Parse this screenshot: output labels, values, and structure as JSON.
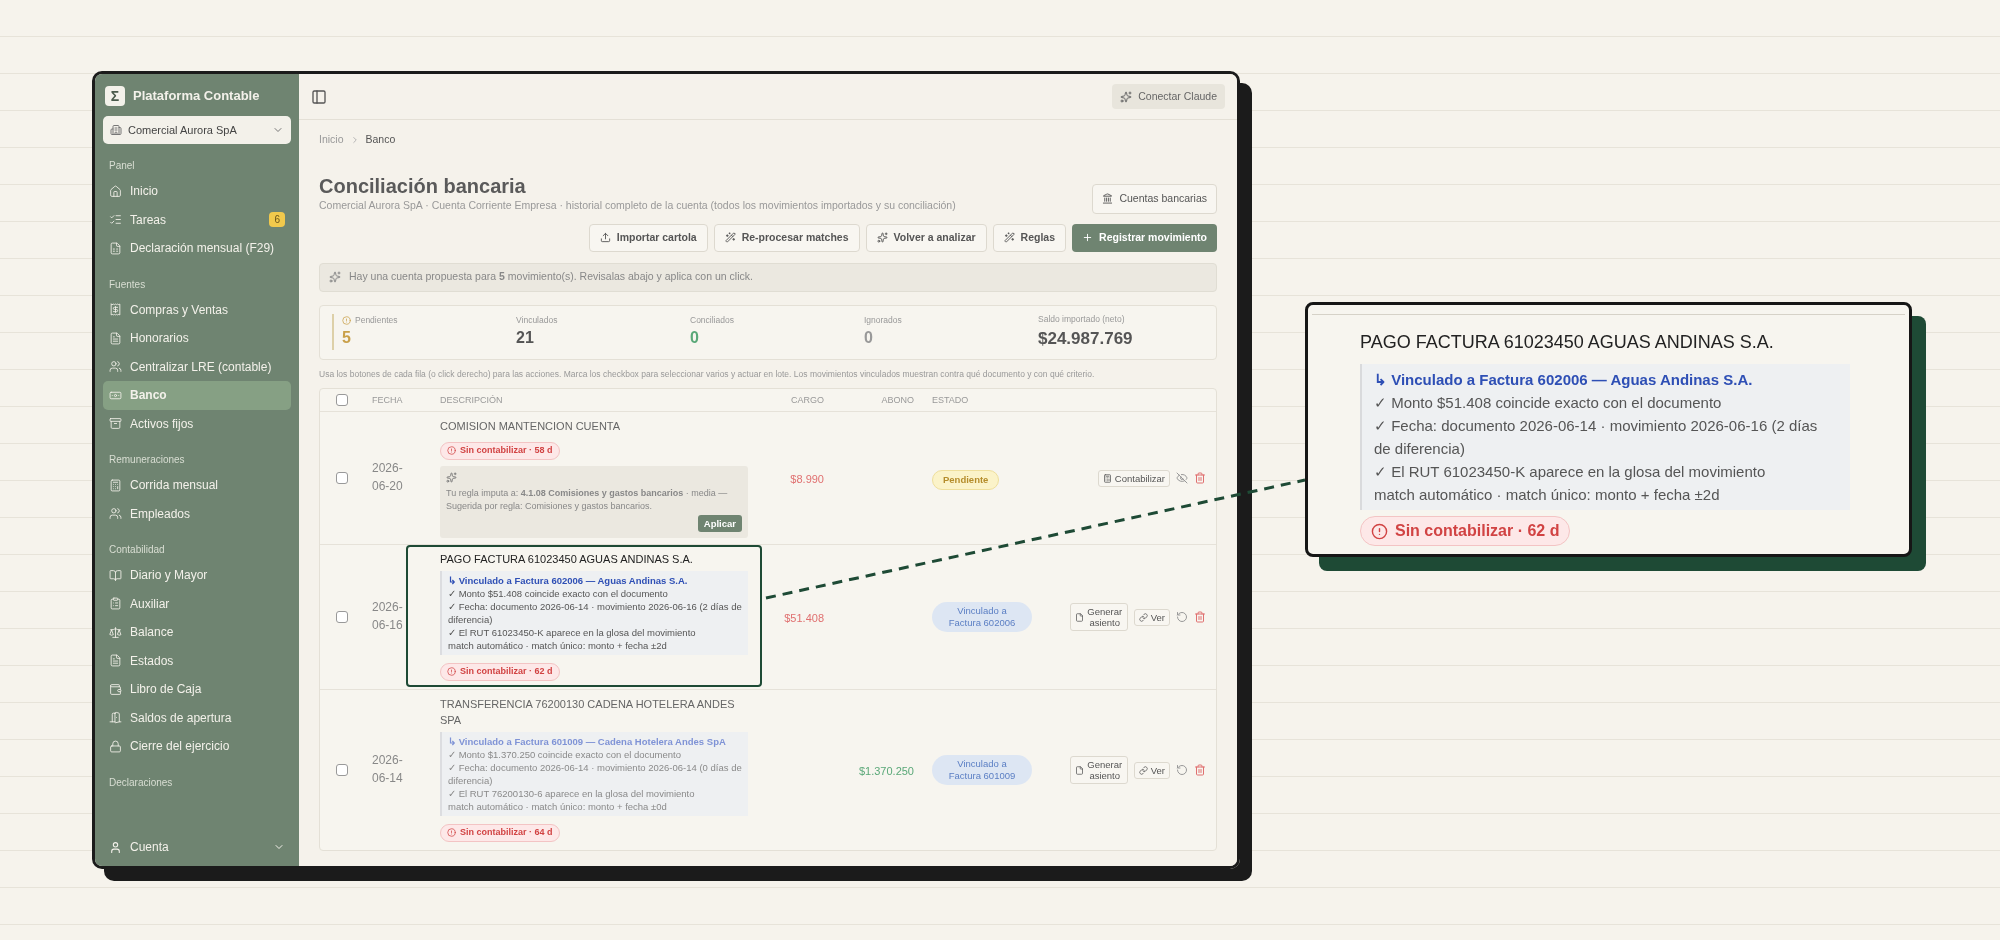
{
  "sidebar": {
    "logo": "Σ",
    "brand": "Plataforma Contable",
    "company": "Comercial Aurora SpA",
    "sections": [
      {
        "title": "Panel",
        "items": [
          {
            "label": "Inicio",
            "selected": false
          },
          {
            "label": "Tareas",
            "selected": false,
            "count": "6"
          },
          {
            "label": "Declaración mensual (F29)",
            "selected": false
          }
        ]
      },
      {
        "title": "Fuentes",
        "items": [
          {
            "label": "Compras y Ventas",
            "selected": false
          },
          {
            "label": "Honorarios",
            "selected": false
          },
          {
            "label": "Centralizar LRE (contable)",
            "selected": false
          },
          {
            "label": "Banco",
            "selected": true
          },
          {
            "label": "Activos fijos",
            "selected": false
          }
        ]
      },
      {
        "title": "Remuneraciones",
        "items": [
          {
            "label": "Corrida mensual",
            "selected": false
          },
          {
            "label": "Empleados",
            "selected": false
          }
        ]
      },
      {
        "title": "Contabilidad",
        "items": [
          {
            "label": "Diario y Mayor",
            "selected": false
          },
          {
            "label": "Auxiliar",
            "selected": false
          },
          {
            "label": "Balance",
            "selected": false
          },
          {
            "label": "Estados",
            "selected": false
          },
          {
            "label": "Libro de Caja",
            "selected": false
          },
          {
            "label": "Saldos de apertura",
            "selected": false
          },
          {
            "label": "Cierre del ejercicio",
            "selected": false
          }
        ]
      },
      {
        "title": "Declaraciones"
      }
    ],
    "account": "Cuenta"
  },
  "topbar": {
    "connect_button": "Conectar Claude"
  },
  "breadcrumb": [
    "Inicio",
    "Banco"
  ],
  "page": {
    "title": "Conciliación bancaria",
    "subtitle": "Comercial Aurora SpA · Cuenta Corriente Empresa · historial completo de la cuenta (todos los movimientos importados y su conciliación)",
    "accounts_button": "Cuentas bancarias"
  },
  "actions": [
    {
      "kind": "import",
      "label": "Importar cartola"
    },
    {
      "kind": "reprocess",
      "label": "Re-procesar matches"
    },
    {
      "kind": "analyze",
      "label": "Volver a analizar"
    },
    {
      "kind": "rules",
      "label": "Reglas"
    },
    {
      "kind": "primary",
      "label": "Registrar movimiento"
    }
  ],
  "notice": "Hay una cuenta propuesta para **5** movimiento(s). Revisalas abajo y aplica con un click.",
  "stats": [
    {
      "label": "Pendientes",
      "value": "5",
      "kind": "warning"
    },
    {
      "label": "Vinculados",
      "value": "21",
      "kind": "neutral"
    },
    {
      "label": "Conciliados",
      "value": "0",
      "kind": "success"
    },
    {
      "label": "Ignorados",
      "value": "0",
      "kind": "muted"
    },
    {
      "label": "Saldo importado (neto)",
      "value": "$24.987.769",
      "kind": "strong"
    }
  ],
  "help": "Usa los botones de cada fila (o click derecho) para las acciones. Marca los checkbox para seleccionar varios y actuar en lote. Los movimientos vinculados muestran contra qué documento y con qué criterio.",
  "table": {
    "select_all": {
      "checked": false
    },
    "columns": [
      "FECHA",
      "DESCRIPCIÓN",
      "CARGO",
      "ABONO",
      "ESTADO"
    ],
    "rows": [
      {
        "checked": false,
        "highlighted": false,
        "date": "2026-06-20",
        "description": "COMISION MANTENCION CUENTA",
        "details": [
          {
            "kind": "badge",
            "text": "Sin contabilizar · 58 d"
          },
          {
            "kind": "suggestion",
            "text": "Tu regla imputa a: **4.1.08 Comisiones y gastos bancarios** · media — Sugerida por regla: Comisiones y gastos bancarios.",
            "button": "Aplicar"
          }
        ],
        "cargo": "$8.990",
        "status": {
          "kind": "pending",
          "label": "Pendiente"
        },
        "actions": [
          {
            "kind": "post",
            "label": "Contabilizar"
          },
          {
            "kind": "hide"
          },
          {
            "kind": "delete"
          }
        ]
      },
      {
        "checked": false,
        "highlighted": true,
        "date": "2026-06-16",
        "description": "PAGO FACTURA 61023450 AGUAS ANDINAS S.A.",
        "details": [
          {
            "kind": "link",
            "title": "↳ Vinculado a Factura 602006 — Aguas Andinas S.A.",
            "lines": [
              "✓ Monto $51.408 coincide exacto con el documento",
              "✓ Fecha: documento 2026-06-14 · movimiento 2026-06-16 (2 días de diferencia)",
              "✓ El RUT 61023450-K aparece en la glosa del movimiento",
              "match automático · match único: monto + fecha ±2d"
            ]
          },
          {
            "kind": "badge",
            "text": "Sin contabilizar · 62 d"
          }
        ],
        "cargo": "$51.408",
        "status": {
          "kind": "linked",
          "label": "Vinculado a Factura 602006"
        },
        "actions": [
          {
            "kind": "entry",
            "label": "Generar asiento"
          },
          {
            "kind": "view",
            "label": "Ver"
          },
          {
            "kind": "undo"
          },
          {
            "kind": "delete"
          }
        ]
      },
      {
        "checked": false,
        "highlighted": false,
        "date": "2026-06-14",
        "description": "TRANSFERENCIA 76200130 CADENA HOTELERA ANDES SPA",
        "details": [
          {
            "kind": "link",
            "title": "↳ Vinculado a Factura 601009 — Cadena Hotelera Andes SpA",
            "lines": [
              "✓ Monto $1.370.250 coincide exacto con el documento",
              "✓ Fecha: documento 2026-06-14 · movimiento 2026-06-14 (0 días de diferencia)",
              "✓ El RUT 76200130-6 aparece en la glosa del movimiento",
              "match automático · match único: monto + fecha ±0d"
            ]
          },
          {
            "kind": "badge",
            "text": "Sin contabilizar · 64 d"
          }
        ],
        "abono": "$1.370.250",
        "status": {
          "kind": "linked",
          "label": "Vinculado a Factura 601009"
        },
        "actions": [
          {
            "kind": "entry",
            "label": "Generar asiento"
          },
          {
            "kind": "view",
            "label": "Ver"
          },
          {
            "kind": "undo"
          },
          {
            "kind": "delete"
          }
        ]
      }
    ]
  },
  "callout": {
    "description": "PAGO FACTURA 61023450 AGUAS ANDINAS S.A.",
    "link_title": "↳ Vinculado a Factura 602006 — Aguas Andinas S.A.",
    "lines": [
      "✓ Monto $51.408 coincide exacto con el documento",
      "✓ Fecha: documento 2026-06-14 · movimiento 2026-06-16 (2 días de diferencia)",
      "✓ El RUT 61023450-K aparece en la glosa del movimiento",
      "match automático · match único: monto + fecha ±2d"
    ],
    "badge": "Sin contabilizar · 62 d"
  }
}
